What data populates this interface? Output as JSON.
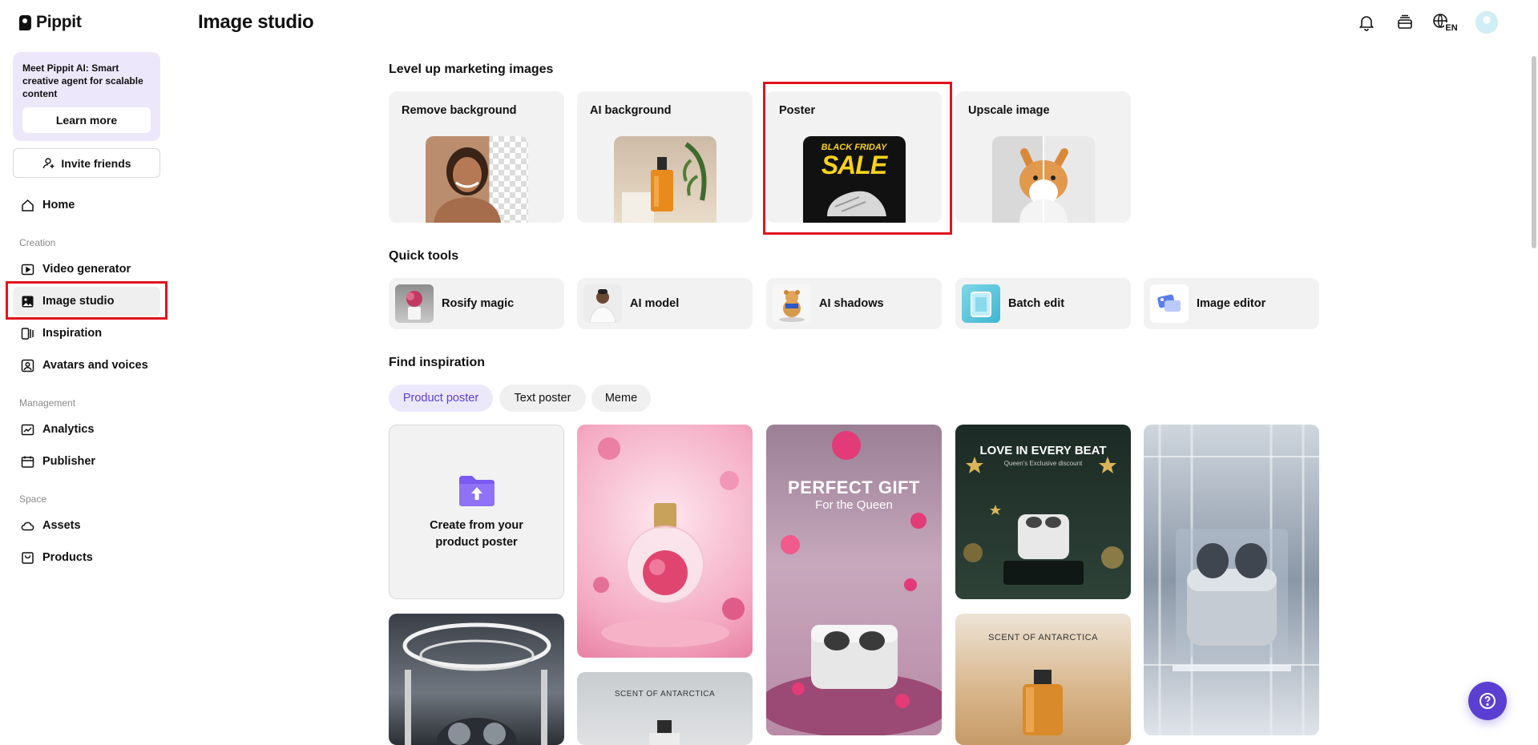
{
  "app": {
    "name": "Pippit"
  },
  "header": {
    "title": "Image studio",
    "language": "EN"
  },
  "sidebar": {
    "promo": {
      "text": "Meet Pippit AI: Smart creative agent for scalable content",
      "button": "Learn more"
    },
    "invite": "Invite friends",
    "home": "Home",
    "sections": {
      "creation": "Creation",
      "management": "Management",
      "space": "Space"
    },
    "items": {
      "video_generator": "Video generator",
      "image_studio": "Image studio",
      "inspiration": "Inspiration",
      "avatars_voices": "Avatars and voices",
      "analytics": "Analytics",
      "publisher": "Publisher",
      "assets": "Assets",
      "products": "Products"
    }
  },
  "marketing": {
    "title": "Level up marketing images",
    "cards": [
      {
        "label": "Remove background"
      },
      {
        "label": "AI background"
      },
      {
        "label": "Poster",
        "art_line1": "BLACK FRIDAY",
        "art_line2": "SALE"
      },
      {
        "label": "Upscale image"
      }
    ]
  },
  "quick_tools": {
    "title": "Quick tools",
    "items": [
      {
        "label": "Rosify magic"
      },
      {
        "label": "AI model"
      },
      {
        "label": "AI shadows"
      },
      {
        "label": "Batch edit"
      },
      {
        "label": "Image editor"
      }
    ]
  },
  "inspiration": {
    "title": "Find inspiration",
    "chips": [
      "Product poster",
      "Text poster",
      "Meme"
    ],
    "create_card": "Create from your product poster",
    "posters": {
      "perfect_gift": {
        "line1": "PERFECT GIFT",
        "line2": "For the Queen"
      },
      "love_beat": {
        "line1": "LOVE IN EVERY BEAT",
        "line2": "Queen's Exclusive discount"
      },
      "scent": "SCENT OF ANTARCTICA"
    }
  },
  "colors": {
    "accent": "#5b3fd1",
    "highlight": "#e0141e",
    "card_bg": "#f2f2f2",
    "promo_bg": "#ede7fb"
  }
}
